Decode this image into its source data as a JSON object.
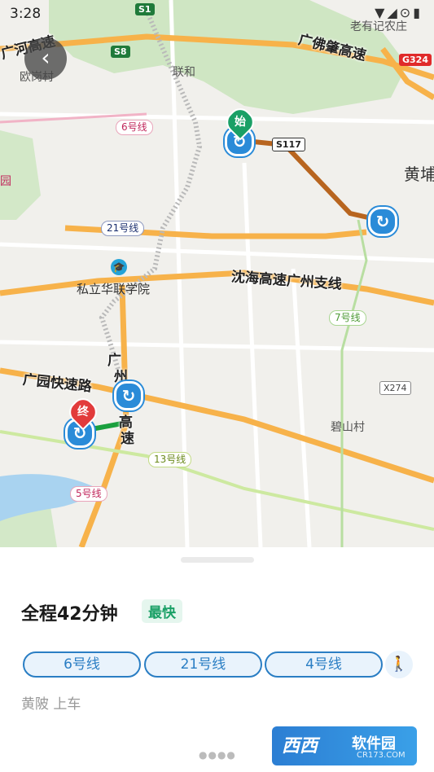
{
  "status_bar": {
    "time": "3:28",
    "icons": "▼◢⊙▮"
  },
  "map": {
    "roads": {
      "guanghe": "广河高速",
      "guangfozhao": "广佛肇高速",
      "shenhai": "沈海高速广州支线",
      "guangyuan": "广园快速路",
      "guangzhou_exp_a": "广",
      "guangzhou_exp_b": "州",
      "guangzhou_exp_c": "高",
      "guangzhou_exp_d": "速"
    },
    "shields": {
      "s1": "S1",
      "s8": "S8",
      "s117": "S117",
      "g324": "G324",
      "x274": "X274"
    },
    "metro_badges": {
      "line6": "6号线",
      "line21": "21号线",
      "line7": "7号线",
      "line13": "13号线",
      "line5": "5号线"
    },
    "places": {
      "ougang": "欧岗村",
      "lianhe": "联和",
      "laoyouji": "老有记农庄",
      "huangpu": "黄埔",
      "hualian": "私立华联学院",
      "bishan": "碧山村",
      "yuan": "园"
    },
    "markers": {
      "start": "始",
      "end": "终"
    },
    "colors": {
      "line6": "#c1275c",
      "line21": "#1b2f6e",
      "line4": "#1aa03e",
      "walk": "#b9b9b9",
      "highway": "#f7b24a"
    }
  },
  "panel": {
    "title": "全程42分钟",
    "fast_badge": "最快",
    "segments": [
      "6号线",
      "21号线",
      "4号线"
    ],
    "board_station": "黄陂",
    "board_action": "上车",
    "page_dots": "●●●●"
  },
  "watermark": {
    "brand": "西西",
    "text": "软件园",
    "url": "CR173.COM"
  }
}
